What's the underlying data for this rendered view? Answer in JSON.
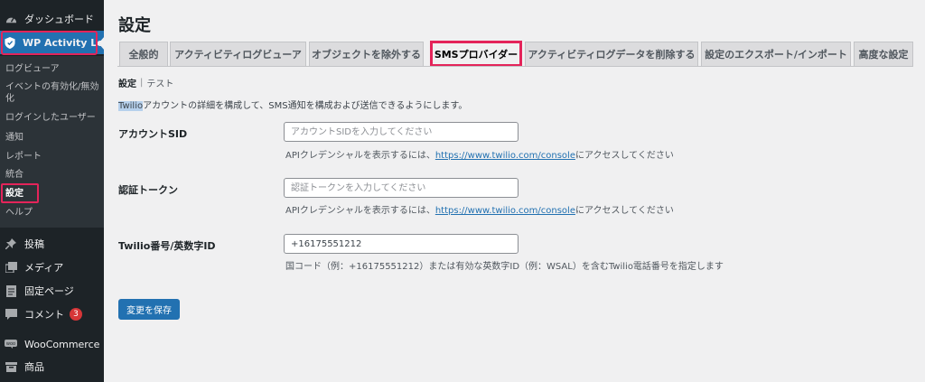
{
  "sidebar": {
    "top_items": [
      {
        "label": "ダッシュボード",
        "icon": "dashboard-icon"
      },
      {
        "label": "WP Activity Log",
        "icon": "shield-icon"
      }
    ],
    "submenu": [
      {
        "label": "ログビューア"
      },
      {
        "label": "イベントの有効化/無効化"
      },
      {
        "label": "ログインしたユーザー"
      },
      {
        "label": "通知"
      },
      {
        "label": "レポート"
      },
      {
        "label": "統合"
      },
      {
        "label": "設定"
      },
      {
        "label": "ヘルプ"
      }
    ],
    "bottom_items": [
      {
        "label": "投稿",
        "icon": "pin-icon"
      },
      {
        "label": "メディア",
        "icon": "media-icon"
      },
      {
        "label": "固定ページ",
        "icon": "page-icon"
      },
      {
        "label": "コメント",
        "icon": "comment-icon",
        "badge": "3"
      },
      {
        "label": "WooCommerce",
        "icon": "woo-icon"
      },
      {
        "label": "商品",
        "icon": "product-icon"
      }
    ]
  },
  "main": {
    "title": "設定",
    "tabs": [
      {
        "label": "全般的"
      },
      {
        "label": "アクティビティログビューア"
      },
      {
        "label": "オブジェクトを除外する"
      },
      {
        "label": "SMSプロバイダー"
      },
      {
        "label": "アクティビティログデータを削除する"
      },
      {
        "label": "設定のエクスポート/インポート"
      },
      {
        "label": "高度な設定"
      }
    ],
    "subnav": {
      "current": "設定",
      "separator": "|",
      "link": "テスト"
    },
    "intro": {
      "highlight": "Twilio",
      "rest": "アカウントの詳細を構成して、SMS通知を構成および送信できるようにします。"
    },
    "fields": [
      {
        "label": "アカウントSID",
        "value": "",
        "placeholder": "アカウントSIDを入力してください",
        "desc_pre": "APIクレデンシャルを表示するには、",
        "desc_link": "https://www.twilio.com/console",
        "desc_post": "にアクセスしてください"
      },
      {
        "label": "認証トークン",
        "value": "",
        "placeholder": "認証トークンを入力してください",
        "desc_pre": "APIクレデンシャルを表示するには、",
        "desc_link": "https://www.twilio.com/console",
        "desc_post": "にアクセスしてください"
      },
      {
        "label": "Twilio番号/英数字ID",
        "value": "+16175551212",
        "placeholder": "",
        "desc_pre": "国コード（例：+16175551212）または有効な英数字ID（例：WSAL）を含むTwilio電話番号を指定します",
        "desc_link": "",
        "desc_post": ""
      }
    ],
    "save_label": "変更を保存"
  },
  "colors": {
    "accent": "#2271b1",
    "highlight_outline": "#e4245a",
    "sidebar_bg": "#1d2327"
  }
}
